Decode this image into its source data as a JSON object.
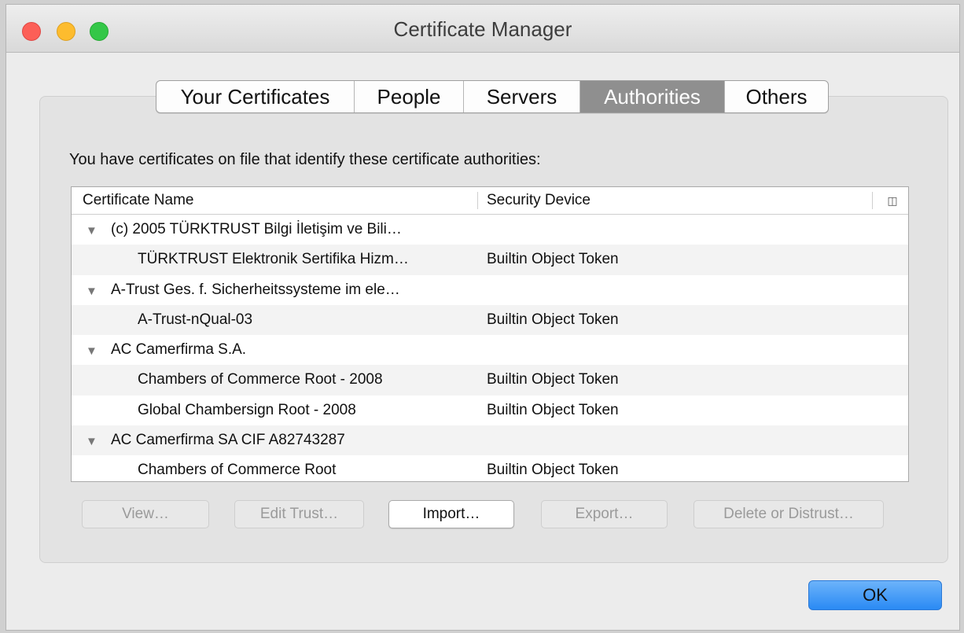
{
  "window": {
    "title": "Certificate Manager"
  },
  "tabs": [
    {
      "label": "Your Certificates",
      "active": false
    },
    {
      "label": "People",
      "active": false
    },
    {
      "label": "Servers",
      "active": false
    },
    {
      "label": "Authorities",
      "active": true
    },
    {
      "label": "Others",
      "active": false
    }
  ],
  "intro_text": "You have certificates on file that identify these certificate authorities:",
  "table": {
    "columns": [
      "Certificate Name",
      "Security Device"
    ],
    "column_picker_icon": "column-picker-icon",
    "rows": [
      {
        "type": "group",
        "name": "(c) 2005 TÜRKTRUST Bilgi İletişim ve Bili…",
        "device": ""
      },
      {
        "type": "child",
        "name": "TÜRKTRUST Elektronik Sertifika Hizm…",
        "device": "Builtin Object Token"
      },
      {
        "type": "group",
        "name": "A-Trust Ges. f. Sicherheitssysteme im ele…",
        "device": ""
      },
      {
        "type": "child",
        "name": "A-Trust-nQual-03",
        "device": "Builtin Object Token"
      },
      {
        "type": "group",
        "name": "AC Camerfirma S.A.",
        "device": ""
      },
      {
        "type": "child",
        "name": "Chambers of Commerce Root - 2008",
        "device": "Builtin Object Token"
      },
      {
        "type": "child",
        "name": "Global Chambersign Root - 2008",
        "device": "Builtin Object Token"
      },
      {
        "type": "group",
        "name": "AC Camerfirma SA CIF A82743287",
        "device": ""
      },
      {
        "type": "child",
        "name": "Chambers of Commerce Root",
        "device": "Builtin Object Token"
      }
    ]
  },
  "buttons": {
    "view": "View…",
    "edit_trust": "Edit Trust…",
    "import": "Import…",
    "export": "Export…",
    "delete_or_distrust": "Delete or Distrust…",
    "ok": "OK"
  },
  "colors": {
    "accent": "#2a8af4",
    "close": "#fc5f57",
    "minimize": "#fdbc2e",
    "maximize": "#34c748",
    "active_tab": "#8f8f8f"
  }
}
